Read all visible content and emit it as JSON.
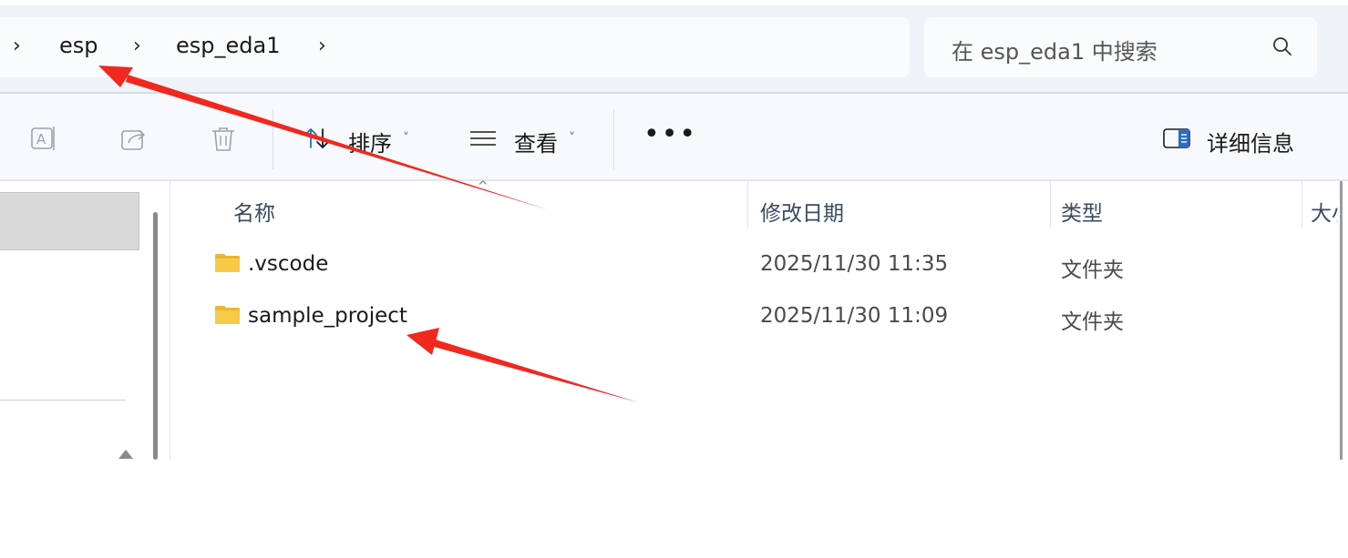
{
  "address_bar": {
    "crumbs": [
      "esp",
      "esp_eda1"
    ],
    "separator": "›"
  },
  "search": {
    "placeholder": "在 esp_eda1 中搜索"
  },
  "toolbar": {
    "sort_label": "排序",
    "view_label": "查看",
    "more_label": "•••",
    "details_label": "详细信息"
  },
  "columns": {
    "name": "名称",
    "modified": "修改日期",
    "type": "类型",
    "size": "大小"
  },
  "files": [
    {
      "name": ".vscode",
      "modified": "2025/11/30 11:35",
      "type": "文件夹"
    },
    {
      "name": "sample_project",
      "modified": "2025/11/30 11:09",
      "type": "文件夹"
    }
  ],
  "colors": {
    "annotation_arrow": "#f0281e",
    "folder_yellow": "#f7c948"
  }
}
